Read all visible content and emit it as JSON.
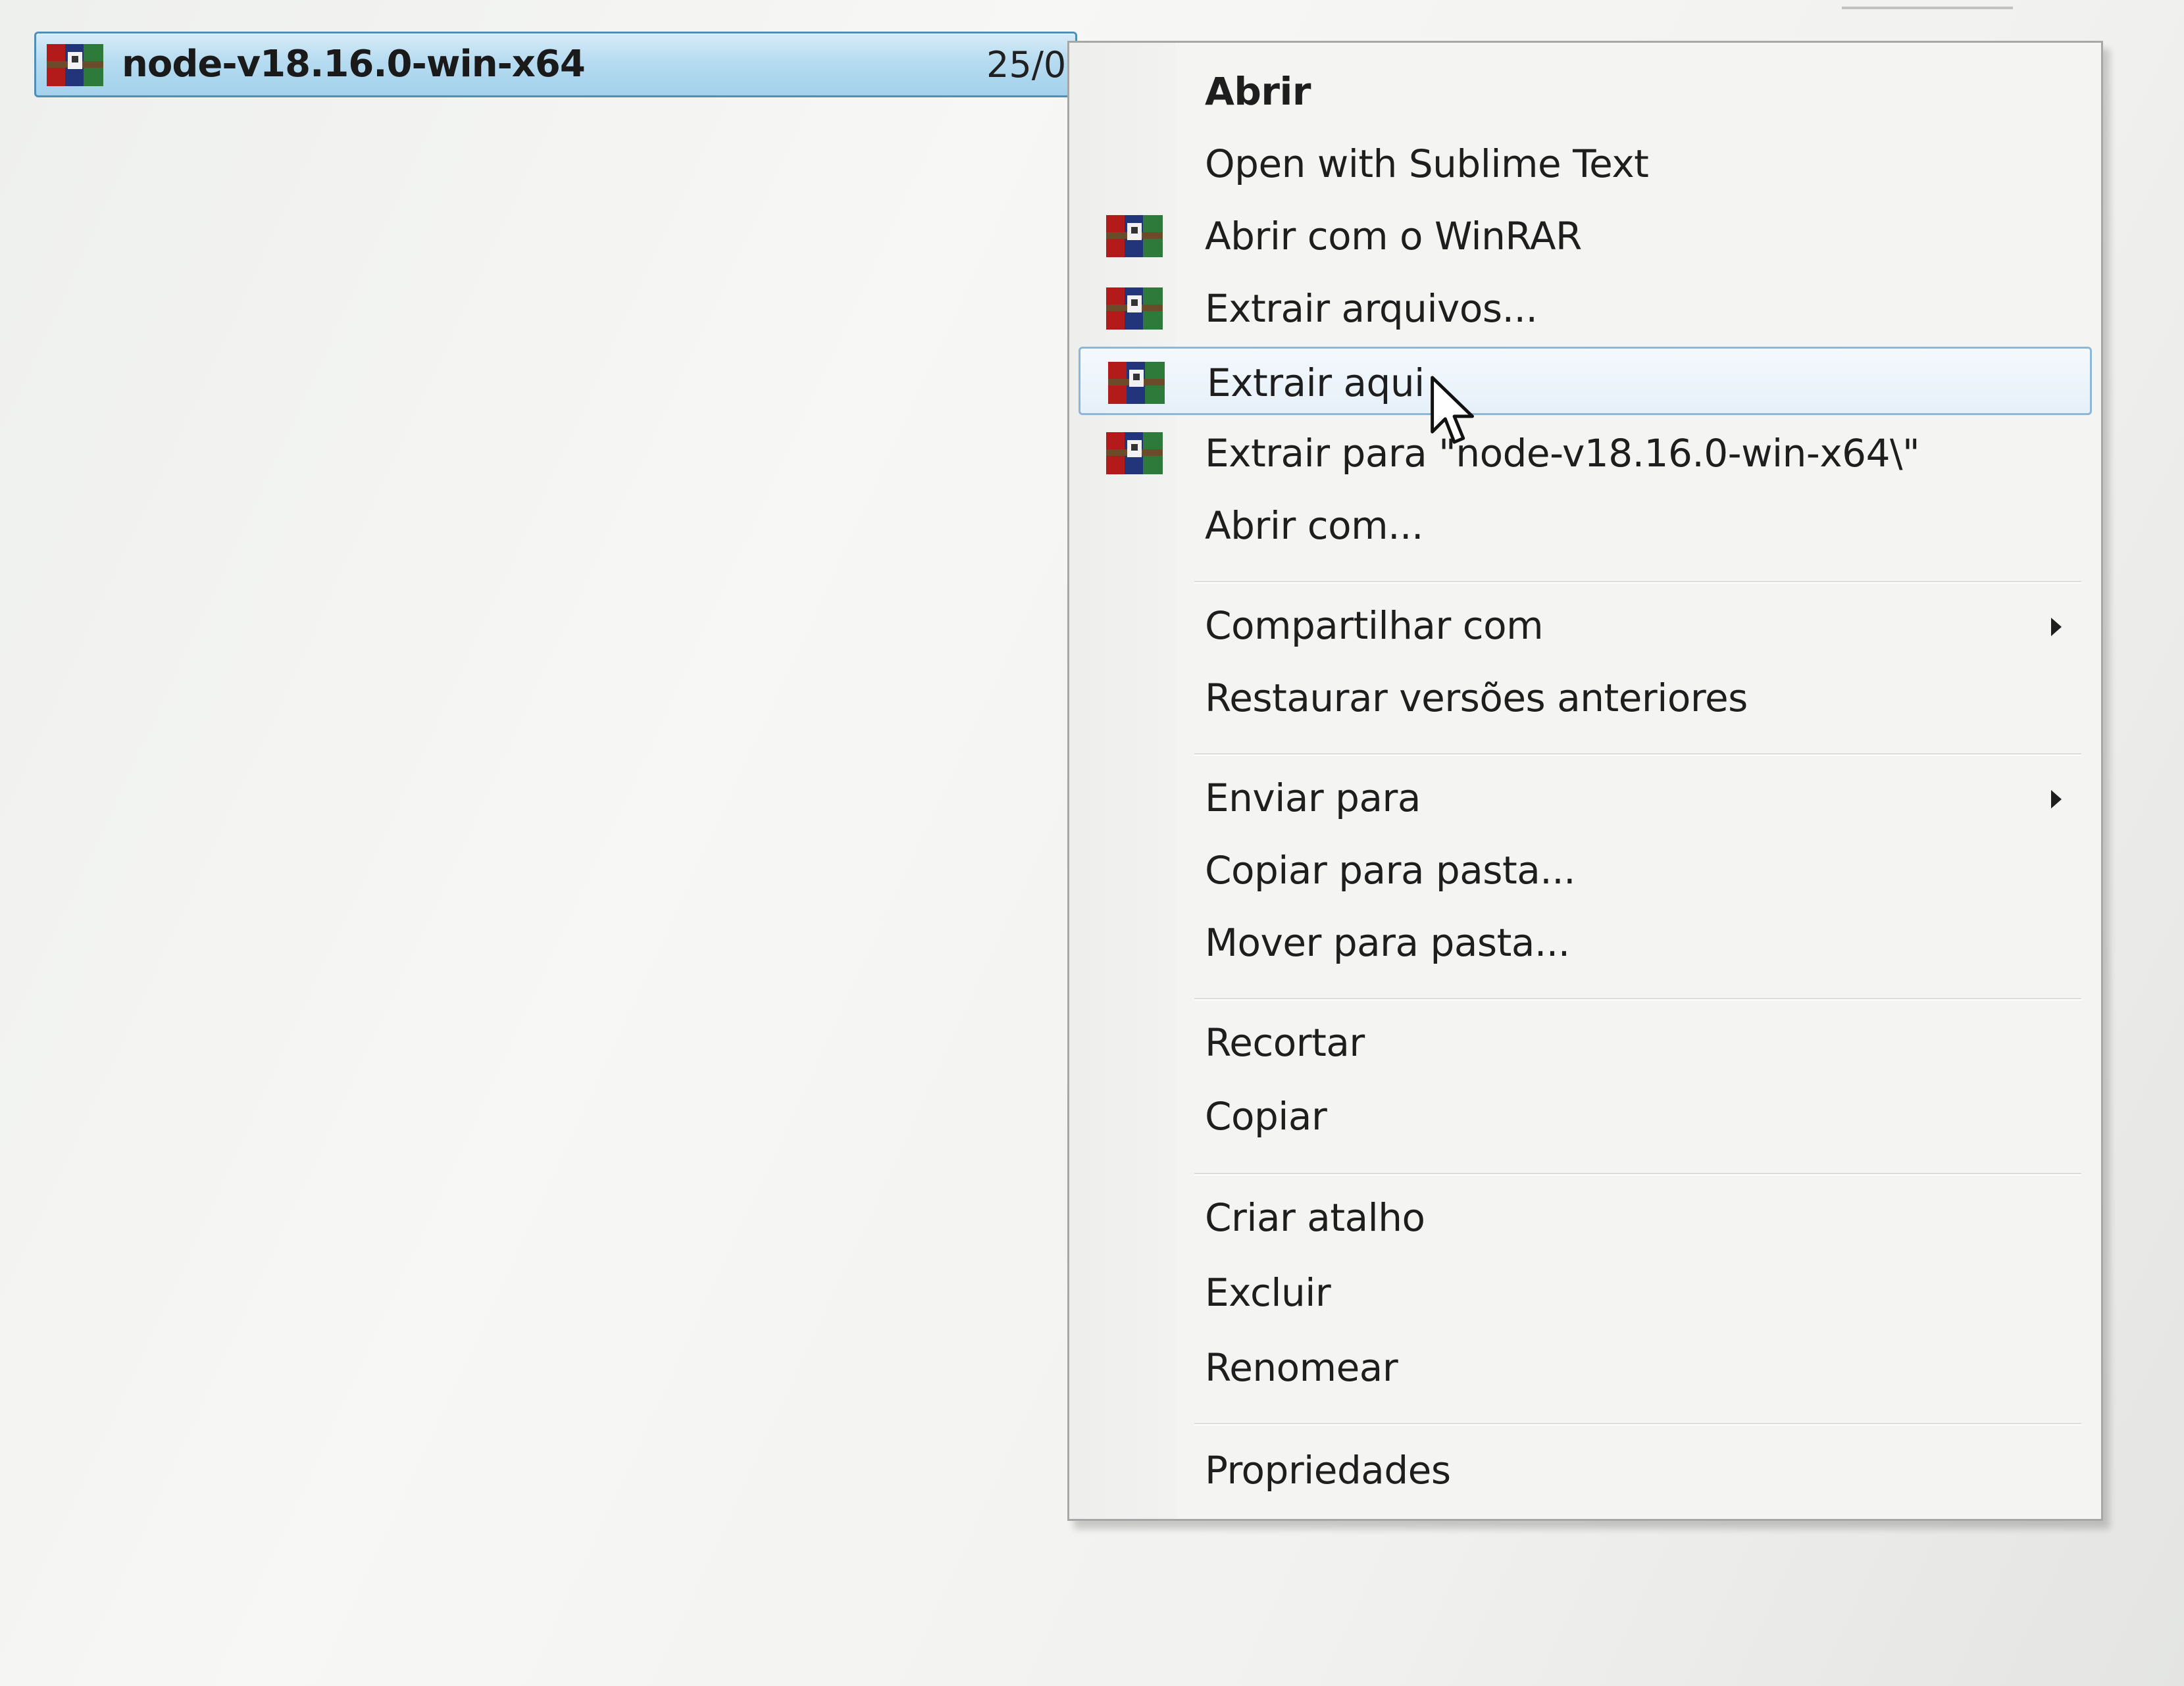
{
  "file": {
    "name": "node-v18.16.0-win-x64",
    "date_fragment": "25/0",
    "icon": "winrar-archive-icon"
  },
  "context_menu": {
    "items": [
      {
        "label": "Abrir",
        "bold": true
      },
      {
        "label": "Open with Sublime Text"
      },
      {
        "label": "Abrir com o WinRAR",
        "icon": "winrar-icon"
      },
      {
        "label": "Extrair arquivos...",
        "icon": "winrar-icon"
      },
      {
        "label": "Extrair aqui",
        "icon": "winrar-icon",
        "highlighted": true
      },
      {
        "label": "Extrair para \"node-v18.16.0-win-x64\\\"",
        "icon": "winrar-icon"
      },
      {
        "label": "Abrir com..."
      },
      {
        "label": "Compartilhar com",
        "submenu": true
      },
      {
        "label": "Restaurar versões anteriores"
      },
      {
        "label": "Enviar para",
        "submenu": true
      },
      {
        "label": "Copiar para pasta..."
      },
      {
        "label": "Mover para pasta..."
      },
      {
        "label": "Recortar"
      },
      {
        "label": "Copiar"
      },
      {
        "label": "Criar atalho"
      },
      {
        "label": "Excluir"
      },
      {
        "label": "Renomear"
      },
      {
        "label": "Propriedades"
      }
    ]
  },
  "colors": {
    "selection_fill": "#b6dbf0",
    "selection_border": "#4e8fb8",
    "menu_background": "#f4f4f3",
    "hover_border": "#8fb6d6"
  }
}
